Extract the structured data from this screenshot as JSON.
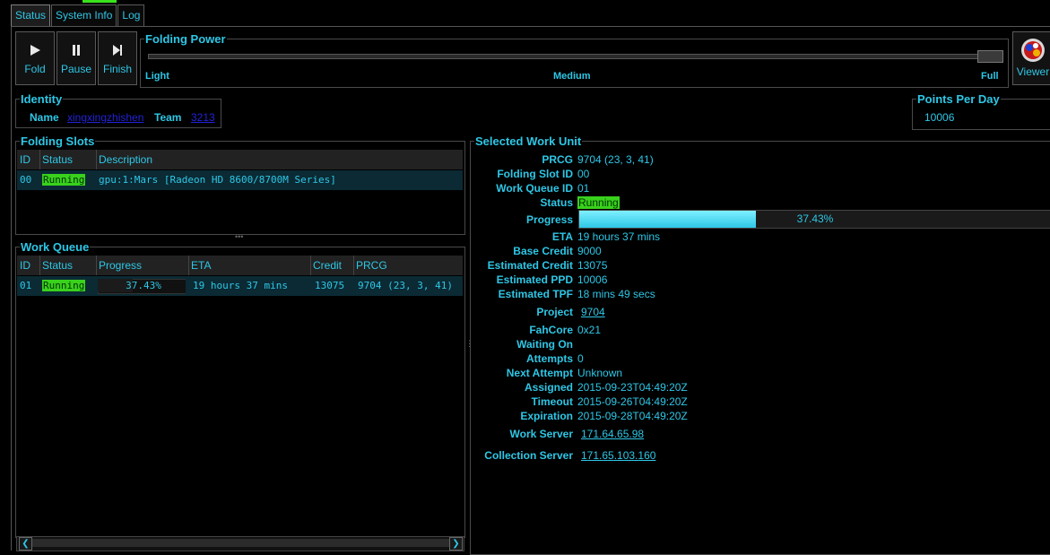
{
  "tabs": [
    "Status",
    "System Info",
    "Log"
  ],
  "toolbar": {
    "fold_label": "Fold",
    "pause_label": "Pause",
    "finish_label": "Finish",
    "viewer_label": "Viewer"
  },
  "folding_power": {
    "title": "Folding Power",
    "light": "Light",
    "medium": "Medium",
    "full": "Full",
    "level": 1.0
  },
  "identity": {
    "title": "Identity",
    "name_label": "Name",
    "name_value": "xingxingzhishen",
    "team_label": "Team",
    "team_value": "3213"
  },
  "ppd": {
    "title": "Points Per Day",
    "value": "10006"
  },
  "folding_slots": {
    "title": "Folding Slots",
    "headers": [
      "ID",
      "Status",
      "Description"
    ],
    "rows": [
      {
        "id": "00",
        "status": "Running",
        "description": "gpu:1:Mars [Radeon HD 8600/8700M Series]"
      }
    ]
  },
  "work_queue": {
    "title": "Work Queue",
    "headers": [
      "ID",
      "Status",
      "Progress",
      "ETA",
      "Credit",
      "PRCG"
    ],
    "rows": [
      {
        "id": "01",
        "status": "Running",
        "progress": "37.43%",
        "progress_value": 37.43,
        "eta": "19 hours 37 mins",
        "credit": "13075",
        "prcg": "9704 (23, 3, 41)"
      }
    ]
  },
  "selected_wu": {
    "title": "Selected Work Unit",
    "prcg_label": "PRCG",
    "prcg": "9704 (23, 3, 41)",
    "slot_label": "Folding Slot ID",
    "slot": "00",
    "queue_label": "Work Queue ID",
    "queue": "01",
    "status_label": "Status",
    "status": "Running",
    "progress_label": "Progress",
    "progress": "37.43%",
    "progress_value": 37.43,
    "eta_label": "ETA",
    "eta": "19 hours 37 mins",
    "base_credit_label": "Base Credit",
    "base_credit": "9000",
    "est_credit_label": "Estimated Credit",
    "est_credit": "13075",
    "est_ppd_label": "Estimated PPD",
    "est_ppd": "10006",
    "est_tpf_label": "Estimated TPF",
    "est_tpf": "18 mins 49 secs",
    "project_label": "Project",
    "project": "9704",
    "fahcore_label": "FahCore",
    "fahcore": "0x21",
    "waiting_label": "Waiting On",
    "waiting": "",
    "attempts_label": "Attempts",
    "attempts": "0",
    "next_attempt_label": "Next Attempt",
    "next_attempt": "Unknown",
    "assigned_label": "Assigned",
    "assigned": "2015-09-23T04:49:20Z",
    "timeout_label": "Timeout",
    "timeout": "2015-09-26T04:49:20Z",
    "expiration_label": "Expiration",
    "expiration": "2015-09-28T04:49:20Z",
    "work_server_label": "Work Server",
    "work_server": "171.64.65.98",
    "collection_server_label": "Collection Server",
    "collection_server": "171.65.103.160"
  },
  "colors": {
    "accent": "#2ec7e6",
    "running": "#39d11c",
    "link": "#2222d8",
    "background": "#000000"
  }
}
